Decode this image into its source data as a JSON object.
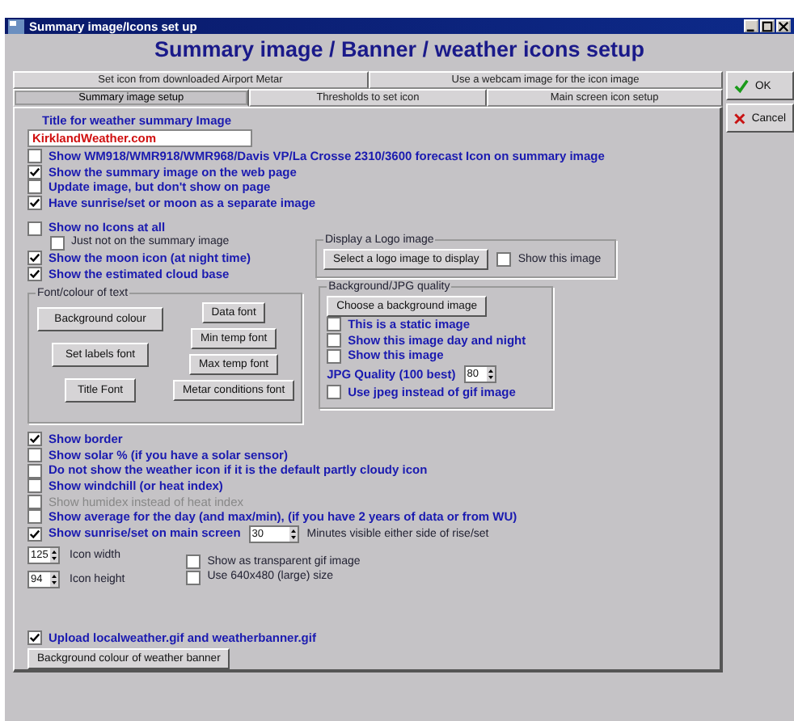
{
  "window": {
    "title": "Summary image/Icons set up"
  },
  "heading": "Summary image  / Banner / weather icons setup",
  "tab_rows": [
    {
      "tabs": [
        {
          "label": "Set icon from downloaded Airport Metar",
          "selected": false
        },
        {
          "label": "Use a webcam image for the icon image",
          "selected": false
        }
      ]
    },
    {
      "tabs": [
        {
          "label": "Summary image setup",
          "selected": true
        },
        {
          "label": "Thresholds to set icon",
          "selected": false
        },
        {
          "label": "Main screen icon setup",
          "selected": false
        }
      ]
    }
  ],
  "dialog_buttons": [
    {
      "label": "OK",
      "kind": "ok"
    },
    {
      "label": "Cancel",
      "kind": "cancel"
    }
  ],
  "title_field": {
    "label": "Title for weather summary Image",
    "value": "KirklandWeather.com"
  },
  "options_top": [
    {
      "label": "Show WM918/WMR918/WMR968/Davis VP/La Crosse 2310/3600 forecast Icon on summary image",
      "checked": false,
      "kind": "main"
    },
    {
      "label": "Show the summary image on the web page",
      "checked": true,
      "kind": "main"
    },
    {
      "label": "Update image, but don't show on page",
      "checked": false,
      "kind": "main"
    },
    {
      "label": "Have sunrise/set or moon as a separate image",
      "checked": true,
      "kind": "main"
    },
    {
      "label": "Show no Icons at all",
      "checked": false,
      "kind": "gap"
    },
    {
      "label": "Just not on the summary image",
      "checked": false,
      "kind": "sub"
    },
    {
      "label": "Show the moon icon (at night time)",
      "checked": true,
      "kind": "main"
    },
    {
      "label": "Show the estimated cloud base",
      "checked": true,
      "kind": "main"
    }
  ],
  "logo_group": {
    "title": "Display a Logo image",
    "button": "Select a logo image to display",
    "option": {
      "label": "Show this image",
      "checked": false
    }
  },
  "font_group": {
    "title": "Font/colour of text",
    "left_buttons": [
      "Background colour",
      "Set labels font",
      "Title Font"
    ],
    "right_buttons": [
      "Data font",
      "Min temp font",
      "Max temp font",
      "Metar conditions font"
    ]
  },
  "background_group": {
    "title": "Background/JPG quality",
    "button": "Choose a background image",
    "options": [
      {
        "label": "This is a static image",
        "checked": false
      },
      {
        "label": "Show this image day and night",
        "checked": false
      },
      {
        "label": "Show this image",
        "checked": false
      }
    ],
    "quality": {
      "label": "JPG Quality (100 best)",
      "value": "80"
    },
    "jpeg_option": {
      "label": "Use jpeg instead of gif image",
      "checked": false
    }
  },
  "options_bottom": [
    {
      "label": "Show border",
      "checked": true,
      "disabled": false
    },
    {
      "label": "Show solar % (if you have a solar sensor)",
      "checked": false,
      "disabled": false
    },
    {
      "label": "Do not show the weather icon if it is the default partly cloudy icon",
      "checked": false,
      "disabled": false
    },
    {
      "label": "Show windchill (or heat index)",
      "checked": false,
      "disabled": false
    },
    {
      "label": "Show humidex instead of heat index",
      "checked": false,
      "disabled": true
    },
    {
      "label": "Show average for the day (and max/min), (if you have 2 years of data or from WU)",
      "checked": false,
      "disabled": false
    }
  ],
  "sunrise_option": {
    "label": "Show sunrise/set on main screen",
    "checked": true,
    "value": "30",
    "suffix": "Minutes visible either side of rise/set"
  },
  "icon_size": [
    {
      "value": "125",
      "label": "Icon width"
    },
    {
      "value": "94",
      "label": "Icon height"
    }
  ],
  "image_options": [
    {
      "label": "Show as transparent gif image",
      "checked": false
    },
    {
      "label": "Use 640x480 (large) size",
      "checked": false
    }
  ],
  "upload_option": {
    "label": "Upload localweather.gif and weatherbanner.gif",
    "checked": true
  },
  "banner_button": "Background colour of weather banner"
}
